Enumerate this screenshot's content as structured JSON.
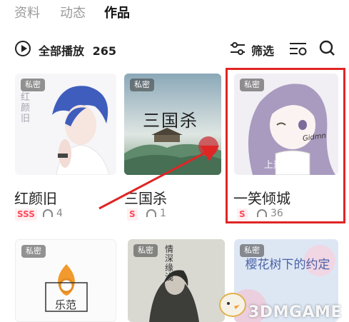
{
  "tabs": [
    {
      "label": "资料"
    },
    {
      "label": "动态"
    },
    {
      "label": "作品",
      "active": true
    }
  ],
  "play_all": {
    "label": "全部播放",
    "count": "265"
  },
  "filter_label": "筛选",
  "icons": [
    "play-icon",
    "filter-icon",
    "playlist-settings-icon",
    "search-icon",
    "headset-icon"
  ],
  "cards": [
    {
      "badge": "私密",
      "title": "红颜旧",
      "quality": "SSS",
      "listens": "4",
      "cover_text": "红颜旧"
    },
    {
      "badge": "私密",
      "title": "三国杀",
      "quality": "S",
      "listens": "1",
      "cover_text": "三国杀"
    },
    {
      "badge": "私密",
      "title": "一笑倾城",
      "quality": "S",
      "listens": "36",
      "cover_tag": "上热门",
      "signature": "Gidmn"
    },
    {
      "badge": "私密",
      "cover_text": "乐范"
    },
    {
      "badge": "私密",
      "cover_text": "情深缘浅"
    },
    {
      "badge": "私密",
      "cover_text": "樱花树下的约定"
    }
  ],
  "watermark": "3DMGAME",
  "colors": {
    "highlight": "#e02525",
    "quality": "#ff4a5b",
    "accent_orange": "#f29a2e"
  }
}
